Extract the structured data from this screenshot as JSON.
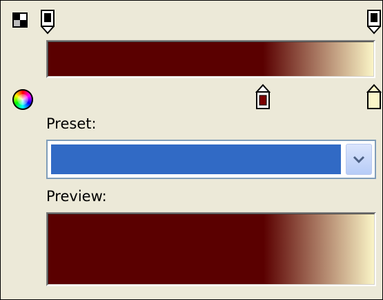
{
  "icons": {
    "transparency": "checker-icon",
    "color_picker": "color-wheel-icon",
    "opacity_stop": "opacity-stop-marker-icon",
    "color_stop": "color-stop-marker-icon",
    "dropdown": "chevron-down-icon"
  },
  "colors": {
    "panel_bg": "#ece9d8",
    "gradient_start": "#5a0000",
    "gradient_end": "#fbf6c8",
    "selection": "#316ac5"
  },
  "gradient": {
    "stops": [
      {
        "position": 0.0,
        "color": "#5a0000"
      },
      {
        "position": 0.66,
        "color": "#5a0000"
      },
      {
        "position": 1.0,
        "color": "#fbf6c8"
      }
    ]
  },
  "opacity_stops": [
    0.0,
    1.0
  ],
  "color_stops": [
    {
      "position": 0.66,
      "color": "#7a0000"
    },
    {
      "position": 1.0,
      "color": "#fbf6c8"
    }
  ],
  "preset": {
    "label": "Preset:",
    "value": ""
  },
  "preview": {
    "label": "Preview:"
  }
}
